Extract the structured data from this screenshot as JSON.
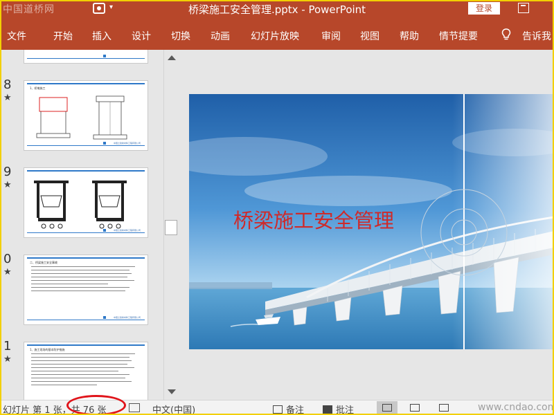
{
  "titlebar": {
    "watermark": "中国道桥网",
    "title": "桥梁施工安全管理.pptx  -  PowerPoint",
    "login_label": "登录"
  },
  "ribbon": {
    "tabs": [
      {
        "label": "文件"
      },
      {
        "label": "开始"
      },
      {
        "label": "插入"
      },
      {
        "label": "设计"
      },
      {
        "label": "切换"
      },
      {
        "label": "动画"
      },
      {
        "label": "幻灯片放映"
      },
      {
        "label": "审阅"
      },
      {
        "label": "视图"
      },
      {
        "label": "帮助"
      },
      {
        "label": "情节提要"
      }
    ],
    "tell_me": "告诉我"
  },
  "thumbnails": [
    {
      "num": "8",
      "star": "★",
      "title": "1、桥墩施工",
      "footer": "中国土建新材料工程有限公司"
    },
    {
      "num": "9",
      "star": "★",
      "title": "",
      "footer": "中国土建新材料工程有限公司"
    },
    {
      "num": "0",
      "star": "★",
      "title": "二、桥梁施工安全事故",
      "footer": "中国土建新材料工程有限公司"
    },
    {
      "num": "1",
      "star": "★",
      "title": "1、施工现场的基本防护措施",
      "footer": ""
    }
  ],
  "slide": {
    "title": "桥梁施工安全管理"
  },
  "statusbar": {
    "slide_info": "幻灯片 第 1 张，共 76 张",
    "language": "中文(中国)",
    "notes_label": "备注",
    "comments_label": "批注",
    "watermark": "www.cndao.com"
  },
  "colors": {
    "accent": "#b7472a",
    "title_red": "#cf2a2a",
    "annotation_red": "#e0141a"
  }
}
